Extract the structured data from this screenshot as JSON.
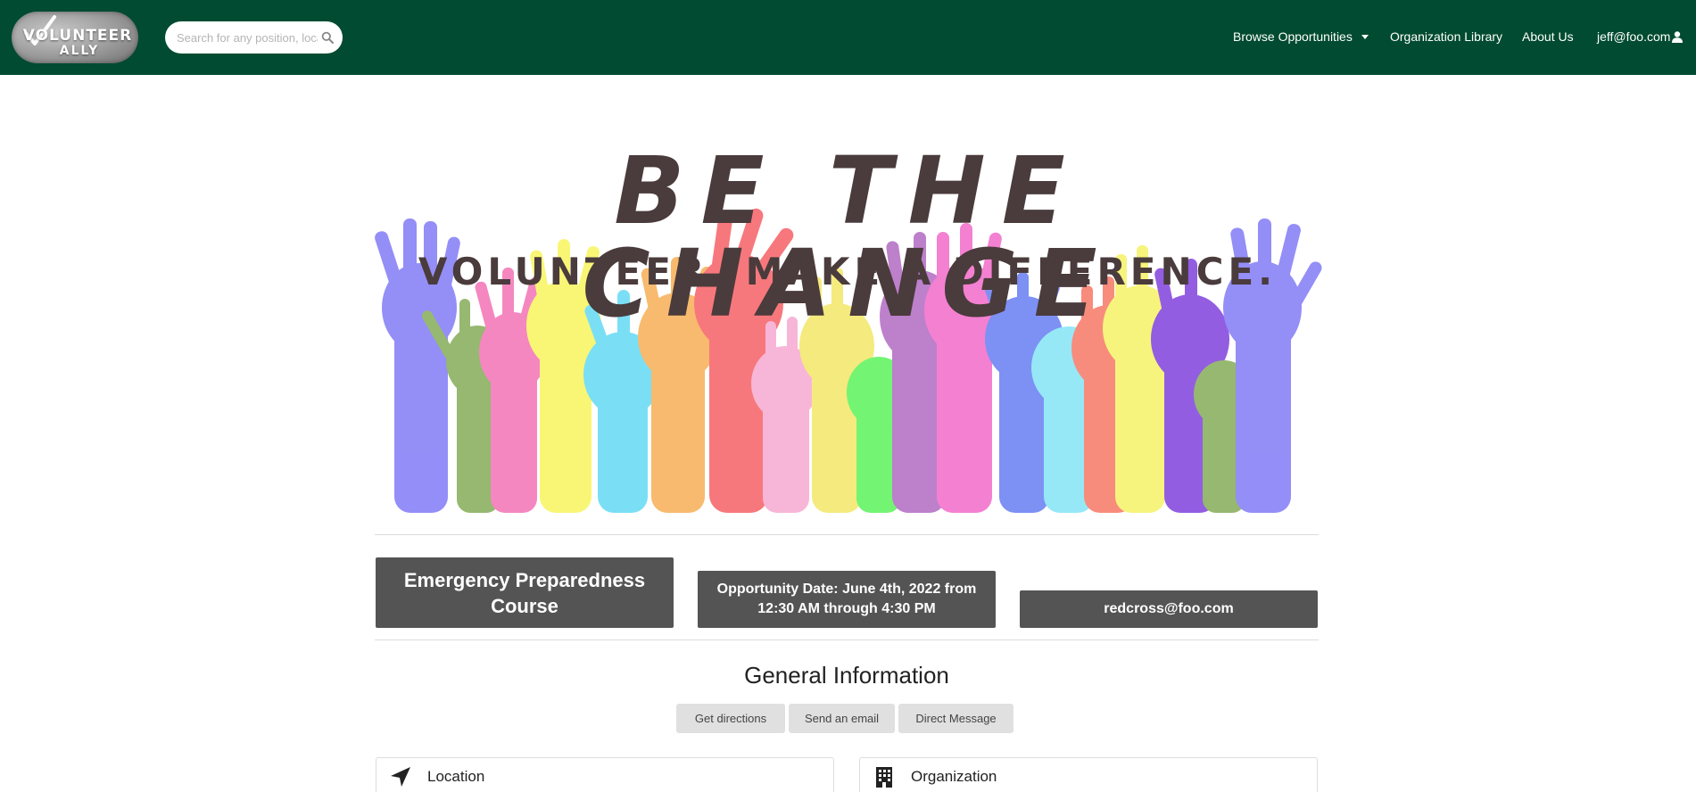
{
  "navbar": {
    "logo_line1": "VOLUNTEER",
    "logo_line2": "ALLY",
    "search_placeholder": "Search for any position, location...",
    "links": {
      "browse": "Browse Opportunities",
      "library": "Organization Library",
      "about": "About Us",
      "user": "jeff@foo.com"
    },
    "background": "#004b31"
  },
  "banner": {
    "title": "BE THE CHANGE",
    "subtitle": "VOLUNTEER. MAKE A DIFFERENCE."
  },
  "opportunity": {
    "name": "Emergency Preparedness Course",
    "date": "Opportunity Date: June 4th, 2022 from 12:30 AM through 4:30 PM",
    "email": "redcross@foo.com"
  },
  "general_info": {
    "title": "General Information",
    "buttons": {
      "directions": "Get directions",
      "email": "Send an email",
      "message": "Direct Message"
    }
  },
  "cards": {
    "location": {
      "title": "Location",
      "icon": "location-arrow-icon"
    },
    "organization": {
      "title": "Organization",
      "icon": "building-icon"
    }
  },
  "colors": {
    "box_bg": "#545454",
    "button_bg": "#e0e0e0",
    "banner_text": "#4a3b3c"
  }
}
